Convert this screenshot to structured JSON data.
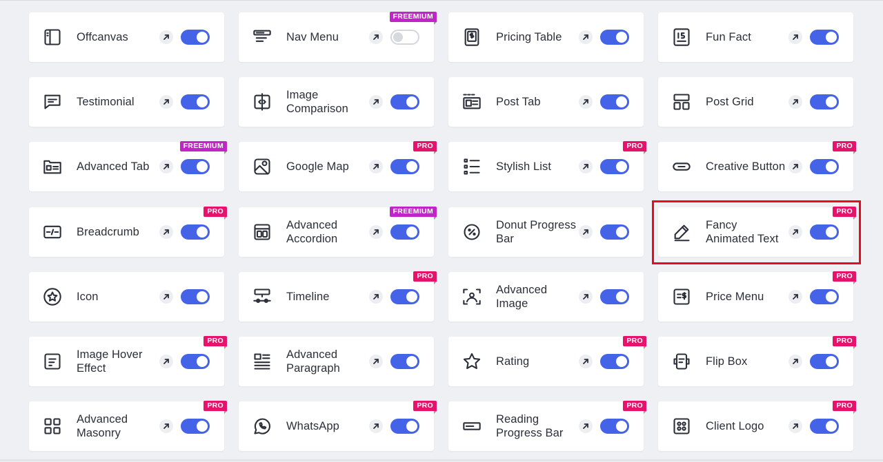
{
  "colors": {
    "toggle_on": "#4563e6",
    "pro_badge": "#e5136b",
    "freemium_badge": "#c125c7",
    "highlight": "#e50d1d"
  },
  "widgets": [
    {
      "lines": [
        "Offcanvas"
      ],
      "icon": "offcanvas-icon",
      "enabled": true,
      "badge": ""
    },
    {
      "lines": [
        "Nav Menu"
      ],
      "icon": "nav-menu-icon",
      "enabled": false,
      "badge": "FREEMIUM"
    },
    {
      "lines": [
        "Pricing Table"
      ],
      "icon": "pricing-table-icon",
      "enabled": true,
      "badge": ""
    },
    {
      "lines": [
        "Fun Fact"
      ],
      "icon": "fun-fact-icon",
      "enabled": true,
      "badge": ""
    },
    {
      "lines": [
        "Testimonial"
      ],
      "icon": "testimonial-icon",
      "enabled": true,
      "badge": ""
    },
    {
      "lines": [
        "Image",
        "Comparison"
      ],
      "icon": "image-comparison-icon",
      "enabled": true,
      "badge": ""
    },
    {
      "lines": [
        "Post Tab"
      ],
      "icon": "post-tab-icon",
      "enabled": true,
      "badge": ""
    },
    {
      "lines": [
        "Post Grid"
      ],
      "icon": "post-grid-icon",
      "enabled": true,
      "badge": ""
    },
    {
      "lines": [
        "Advanced Tab"
      ],
      "icon": "advanced-tab-icon",
      "enabled": true,
      "badge": "FREEMIUM"
    },
    {
      "lines": [
        "Google Map"
      ],
      "icon": "google-map-icon",
      "enabled": true,
      "badge": "PRO"
    },
    {
      "lines": [
        "Stylish List"
      ],
      "icon": "stylish-list-icon",
      "enabled": true,
      "badge": "PRO"
    },
    {
      "lines": [
        "Creative Button"
      ],
      "icon": "creative-button-icon",
      "enabled": true,
      "badge": "PRO"
    },
    {
      "lines": [
        "Breadcrumb"
      ],
      "icon": "breadcrumb-icon",
      "enabled": true,
      "badge": "PRO"
    },
    {
      "lines": [
        "Advanced",
        "Accordion"
      ],
      "icon": "advanced-accordion-icon",
      "enabled": true,
      "badge": "FREEMIUM"
    },
    {
      "lines": [
        "Donut Progress",
        "Bar"
      ],
      "icon": "donut-progress-icon",
      "enabled": true,
      "badge": ""
    },
    {
      "lines": [
        "Fancy",
        "Animated Text"
      ],
      "icon": "fancy-animated-text-icon",
      "enabled": true,
      "badge": "PRO",
      "highlighted": true
    },
    {
      "lines": [
        "Icon"
      ],
      "icon": "star-circle-icon",
      "enabled": true,
      "badge": ""
    },
    {
      "lines": [
        "Timeline"
      ],
      "icon": "timeline-icon",
      "enabled": true,
      "badge": "PRO"
    },
    {
      "lines": [
        "Advanced",
        "Image"
      ],
      "icon": "advanced-image-icon",
      "enabled": true,
      "badge": ""
    },
    {
      "lines": [
        "Price Menu"
      ],
      "icon": "price-menu-icon",
      "enabled": true,
      "badge": "PRO"
    },
    {
      "lines": [
        "Image Hover",
        "Effect"
      ],
      "icon": "image-hover-icon",
      "enabled": true,
      "badge": "PRO"
    },
    {
      "lines": [
        "Advanced",
        "Paragraph"
      ],
      "icon": "advanced-paragraph-icon",
      "enabled": true,
      "badge": ""
    },
    {
      "lines": [
        "Rating"
      ],
      "icon": "star-icon",
      "enabled": true,
      "badge": "PRO"
    },
    {
      "lines": [
        "Flip Box"
      ],
      "icon": "flip-box-icon",
      "enabled": true,
      "badge": "PRO"
    },
    {
      "lines": [
        "Advanced",
        "Masonry"
      ],
      "icon": "advanced-masonry-icon",
      "enabled": true,
      "badge": "PRO"
    },
    {
      "lines": [
        "WhatsApp"
      ],
      "icon": "whatsapp-icon",
      "enabled": true,
      "badge": "PRO"
    },
    {
      "lines": [
        "Reading",
        "Progress Bar"
      ],
      "icon": "reading-progress-icon",
      "enabled": true,
      "badge": "PRO"
    },
    {
      "lines": [
        "Client Logo"
      ],
      "icon": "client-logo-icon",
      "enabled": true,
      "badge": "PRO"
    }
  ]
}
